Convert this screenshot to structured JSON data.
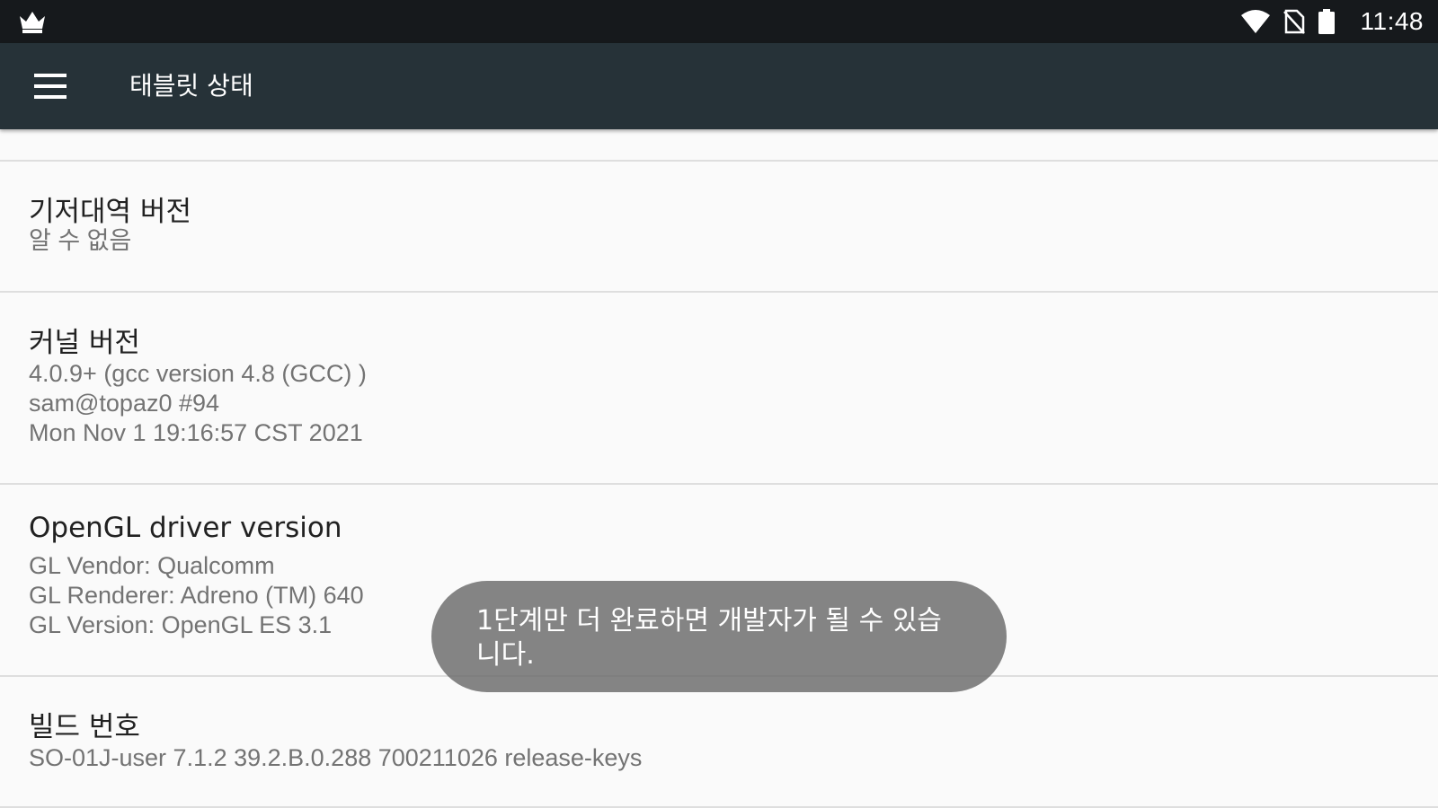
{
  "status_bar": {
    "time": "11:48",
    "icons": [
      "crown-icon",
      "wifi-icon",
      "no-sim-icon",
      "battery-icon"
    ]
  },
  "app_bar": {
    "title": "태블릿 상태",
    "menu_icon": "hamburger-menu-icon"
  },
  "items": [
    {
      "title": "기저대역 버전",
      "lines": [
        "알 수 없음"
      ]
    },
    {
      "title": "커널 버전",
      "lines": [
        "4.0.9+ (gcc version 4.8 (GCC) )",
        "sam@topaz0 #94",
        "Mon Nov 1 19:16:57 CST 2021"
      ]
    },
    {
      "title": "OpenGL driver version",
      "lines": [
        "GL Vendor: Qualcomm",
        "GL Renderer: Adreno (TM) 640",
        "GL Version: OpenGL ES 3.1"
      ]
    },
    {
      "title": "빌드 번호",
      "lines": [
        "SO-01J-user 7.1.2 39.2.B.0.288 700211026 release-keys"
      ]
    }
  ],
  "toast": {
    "lines": [
      "1단계만 더 완료하면 개발자가 될 수 있습",
      "니다."
    ]
  },
  "colors": {
    "status_bar": "#16191c",
    "app_bar": "#263238",
    "background": "#fafafa",
    "toast": "#6e6e6e"
  }
}
